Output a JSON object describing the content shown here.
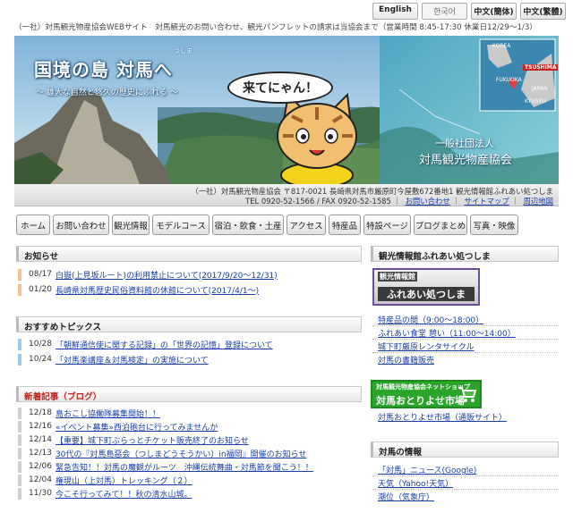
{
  "languages": [
    "English",
    "한국어",
    "中文(簡体)",
    "中文(繁體)"
  ],
  "top_notice": "（一社）対馬観光物産協会WEBサイト　対馬観光のお問い合わせ、観光パンフレットの請求は当協会まで（営業時間 8:45-17:30 休業日12/29～1/3）",
  "banner": {
    "title": "国境の島 対馬へ",
    "ruby": "つしま",
    "subtitle": "～ 雄大な自然と悠久の歴史にふれる ～",
    "bubble": "来てにゃん！",
    "org_line1": "一般社団法人",
    "org_line2": "対馬観光物産協会",
    "map_labels": [
      "KOREA",
      "TSUSHIMA",
      "FUKUOKA",
      "JAPAN",
      "KYUSYU"
    ]
  },
  "address": {
    "line1": "（一社）対馬観光物産協会 〒817-0021 長崎県対馬市厳原町今屋敷672番地1 観光情報館ふれあい処つしま",
    "tel": "TEL 0920-52-1566 / FAX 0920-52-1585",
    "links": [
      "お問い合わせ",
      "サイトマップ",
      "周辺地図"
    ]
  },
  "nav": [
    "ホーム",
    "お問い合わせ",
    "観光情報",
    "モデルコース",
    "宿泊・飲食・土産",
    "アクセス",
    "特産品",
    "特設ページ",
    "ブログまとめ",
    "写真・映像"
  ],
  "notices": {
    "title": "お知らせ",
    "items": [
      {
        "date": "08/17",
        "text": "白嶽(上見坂ルート)の利用禁止について(2017/9/20～12/31)"
      },
      {
        "date": "01/20",
        "text": "長崎県対馬歴史民俗資料館の休館について(2017/4/1～)"
      }
    ]
  },
  "topics": {
    "title": "おすすめトピックス",
    "items": [
      {
        "date": "10/28",
        "text": "「朝鮮通信使に関する記録」の「世界の記憶」登録について"
      },
      {
        "date": "10/24",
        "text": "「対馬楽講座＆対馬検定」の実施について"
      }
    ]
  },
  "blog": {
    "title": "新着記事（ブログ）",
    "items": [
      {
        "date": "12/18",
        "text": "島おこし協働隊募集開始！！"
      },
      {
        "date": "12/16",
        "text": "«イベント募集»西泊砲台に行ってみませんか"
      },
      {
        "date": "12/14",
        "text": "【重要】城下町ぶらっとチケット販売終了のお知らせ"
      },
      {
        "date": "12/13",
        "text": "30代の『対馬島惡会（つしまどうそうかい）in福岡』開催のお知らせ"
      },
      {
        "date": "12/06",
        "text": "緊急告知！！対馬の魔観がルーツ　沖縄伝統舞曲・対馬節を聞こう！！"
      },
      {
        "date": "12/04",
        "text": "権現山（上対馬）トレッキング（２）"
      },
      {
        "date": "11/30",
        "text": "今こそ行ってみて！！秋の清水山城。"
      }
    ]
  },
  "sidebar": {
    "info_title": "観光情報館ふれあい処つしま",
    "badge1_top": "観光情報館",
    "badge1_main": "ふれあい処つしま",
    "links1": [
      "特産品の間（9:00～18:00）",
      "ふれあい食堂 憩い（11:00～14:00）",
      "城下町厳原レンタサイクル",
      "対馬の書籍販売"
    ],
    "badge2_top": "対馬観光物産協会ネットショップ",
    "badge2_main": "対馬おとりよせ市場",
    "links2": [
      "対馬おとりよせ市場（通販サイト）"
    ],
    "tsushima_title": "対馬の情報",
    "links3": [
      "「対馬」ニュース(Google)",
      "天気（Yahoo!天気）",
      "潮位（気象庁）"
    ]
  },
  "colors": {
    "link": "#1a3fa8",
    "blog_header": "#c0261e",
    "notice_marker": "#f0c190",
    "topic_marker": "#9ec8ea",
    "shop_badge": "#2aa42a"
  }
}
